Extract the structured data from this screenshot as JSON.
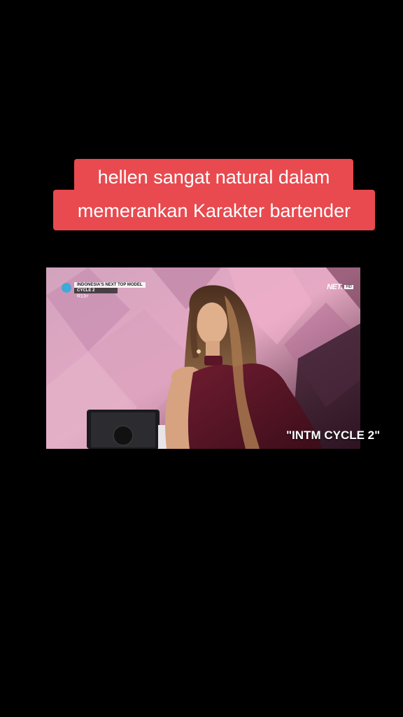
{
  "caption": {
    "line1": "hellen sangat natural dalam",
    "line2": "memerankan Karakter bartender"
  },
  "video": {
    "show_tag": {
      "title": "INDONESIA'S NEXT TOP MODEL",
      "cycle": "CYCLE 2",
      "rating": "R13+"
    },
    "channel_logo": {
      "name": "NET.",
      "badge": "HD"
    },
    "overlay_text": "\"INTM CYCLE 2\""
  },
  "colors": {
    "background": "#000000",
    "caption_bg": "#e84a4f",
    "caption_text": "#ffffff",
    "dress": "#5a1526"
  }
}
